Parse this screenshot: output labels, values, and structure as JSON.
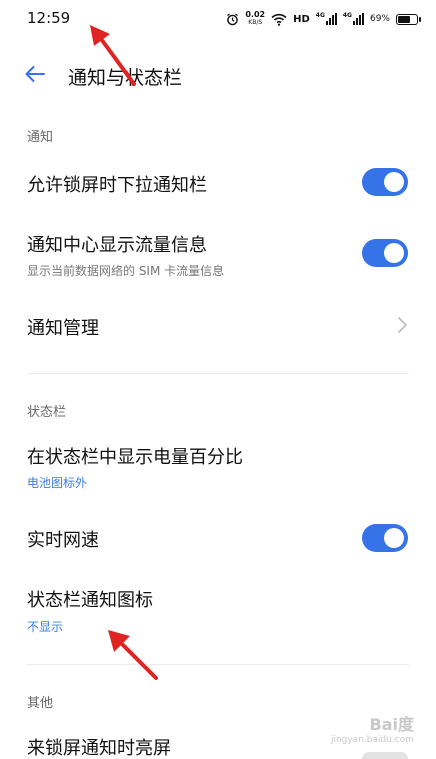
{
  "status_bar": {
    "time": "12:59",
    "net_speed_value": "0.02",
    "net_speed_unit": "KB/S",
    "hd_label": "HD",
    "signal1_label": "4G",
    "signal2_label": "4G",
    "battery_percent": "69%",
    "battery_level": 0.69
  },
  "header": {
    "title": "通知与状态栏"
  },
  "notifications_section": {
    "label": "通知",
    "items": [
      {
        "title": "允许锁屏时下拉通知栏",
        "toggle": true
      },
      {
        "title": "通知中心显示流量信息",
        "subtitle": "显示当前数据网络的 SIM 卡流量信息",
        "toggle": true
      },
      {
        "title": "通知管理"
      }
    ]
  },
  "status_section": {
    "label": "状态栏",
    "items": [
      {
        "title": "在状态栏中显示电量百分比",
        "subtitle": "电池图标外"
      },
      {
        "title": "实时网速",
        "toggle": true
      },
      {
        "title": "状态栏通知图标",
        "subtitle": "不显示"
      }
    ]
  },
  "other_section": {
    "label": "其他",
    "items": [
      {
        "title": "来锁屏通知时亮屏"
      }
    ]
  },
  "watermark": {
    "main": "Bai度",
    "sub": "jingyan.baidu.com"
  },
  "colors": {
    "accent": "#3672e8",
    "link": "#3d7fe0",
    "annotation_arrow": "#e02424"
  }
}
